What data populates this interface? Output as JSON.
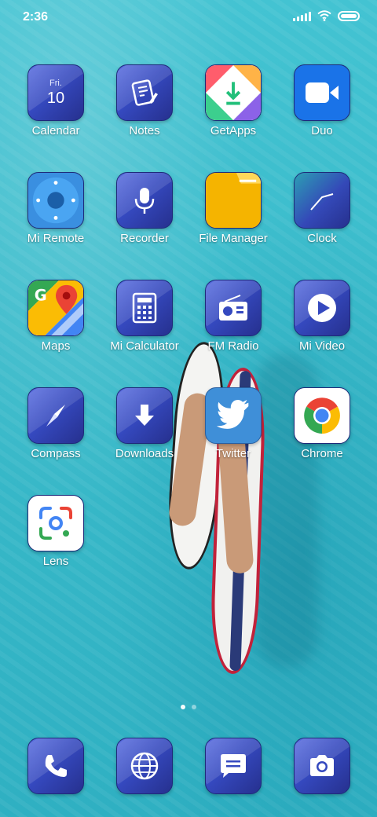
{
  "status_bar": {
    "time": "2:36",
    "icons": [
      "signal-icon",
      "wifi-icon",
      "battery-icon"
    ]
  },
  "apps": [
    {
      "label": "Calendar",
      "icon": "calendar-icon",
      "day": "Fri.",
      "date": "10"
    },
    {
      "label": "Notes",
      "icon": "notes-icon"
    },
    {
      "label": "GetApps",
      "icon": "getapps-icon"
    },
    {
      "label": "Duo",
      "icon": "duo-video-icon"
    },
    {
      "label": "Mi Remote",
      "icon": "remote-icon"
    },
    {
      "label": "Recorder",
      "icon": "microphone-icon"
    },
    {
      "label": "File Manager",
      "icon": "folder-icon"
    },
    {
      "label": "Clock",
      "icon": "clock-icon"
    },
    {
      "label": "Maps",
      "icon": "maps-icon"
    },
    {
      "label": "Mi Calculator",
      "icon": "calculator-icon"
    },
    {
      "label": "FM Radio",
      "icon": "radio-icon"
    },
    {
      "label": "Mi Video",
      "icon": "play-icon"
    },
    {
      "label": "Compass",
      "icon": "compass-icon"
    },
    {
      "label": "Downloads",
      "icon": "download-icon"
    },
    {
      "label": "Twitter",
      "icon": "twitter-icon"
    },
    {
      "label": "Chrome",
      "icon": "chrome-icon"
    },
    {
      "label": "Lens",
      "icon": "lens-icon"
    }
  ],
  "dock": [
    {
      "icon": "phone-icon"
    },
    {
      "icon": "browser-globe-icon"
    },
    {
      "icon": "messages-icon"
    },
    {
      "icon": "camera-icon"
    }
  ],
  "page_indicator": {
    "current": 1,
    "total": 2
  },
  "colors": {
    "theme_icon": "#3549bf",
    "water": "#3fc0cf"
  }
}
